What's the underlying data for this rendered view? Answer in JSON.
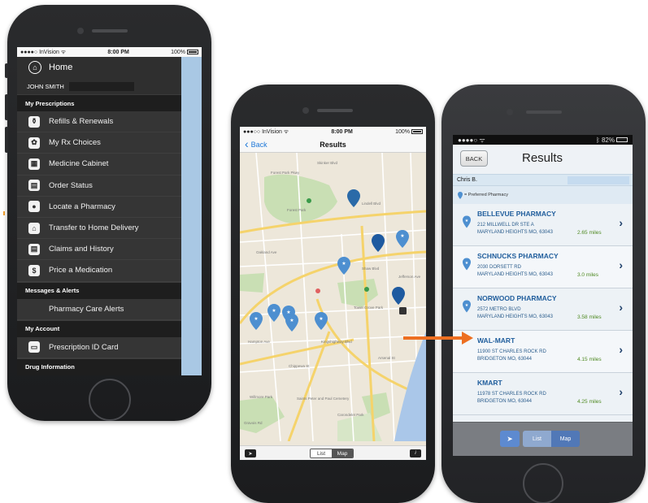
{
  "phone1": {
    "status": {
      "carrier": "●●●●○ InVision ᯤ",
      "time": "8:00 PM",
      "battery": "100%"
    },
    "home_label": "Home",
    "user_name": "JOHN SMITH",
    "sections": [
      {
        "title": "My Prescriptions",
        "items": [
          {
            "label": "Refills & Renewals",
            "icon": "pill-bottle-icon",
            "glyph": "⚱"
          },
          {
            "label": "My Rx Choices",
            "icon": "rx-choices-icon",
            "glyph": "✿"
          },
          {
            "label": "Medicine Cabinet",
            "icon": "cabinet-icon",
            "glyph": "▦"
          },
          {
            "label": "Order Status",
            "icon": "order-status-icon",
            "glyph": "▤"
          },
          {
            "label": "Locate a Pharmacy",
            "icon": "location-pin-icon",
            "glyph": "●"
          },
          {
            "label": "Transfer to Home Delivery",
            "icon": "house-icon",
            "glyph": "⌂"
          },
          {
            "label": "Claims and History",
            "icon": "claims-icon",
            "glyph": "▤"
          },
          {
            "label": "Price a Medication",
            "icon": "dollar-icon",
            "glyph": "$"
          }
        ]
      },
      {
        "title": "Messages & Alerts",
        "items": [
          {
            "label": "Pharmacy Care Alerts",
            "icon": "",
            "glyph": ""
          }
        ]
      },
      {
        "title": "My Account",
        "items": [
          {
            "label": "Prescription ID Card",
            "icon": "id-card-icon",
            "glyph": "▭"
          }
        ]
      },
      {
        "title": "Drug Information",
        "items": []
      }
    ]
  },
  "phone2": {
    "status": {
      "carrier": "●●●○○ InVision ᯤ",
      "time": "8:00 PM",
      "battery": "100%"
    },
    "back_label": "Back",
    "title": "Results",
    "map_labels": [
      "Forest Park Pkwy",
      "Forest Park",
      "Skinker Blvd",
      "Lindell Blvd",
      "Oakland Ave",
      "Tower Grove Park",
      "Shaw Blvd",
      "Arsenal St",
      "Gravois Rd",
      "Carondelet Park",
      "Willmore Park",
      "Saints Peter and Paul Cemetery",
      "Chippewa St",
      "Hampton Ave",
      "Kingshighway Blvd",
      "Jefferson Ave"
    ],
    "segment": {
      "list": "List",
      "map": "Map"
    },
    "info_label": "i"
  },
  "phone3": {
    "status": {
      "carrier": "●●●●○ ᯤ",
      "battery": "82%"
    },
    "back_label": "BACK",
    "title": "Results",
    "user": "Chris B.",
    "preferred_legend": "= Preferred Pharmacy",
    "pharmacies": [
      {
        "name": "BELLEVUE PHARMACY",
        "addr1": "212 MILLWELL DR STE A",
        "addr2": "MARYLAND HEIGHTS MO, 63043",
        "distance": "2.65 miles",
        "preferred": true
      },
      {
        "name": "SCHNUCKS PHARMACY",
        "addr1": "2030 DORSETT RD",
        "addr2": "MARYLAND HEIGHTS MO, 63043",
        "distance": "3.0 miles",
        "preferred": true
      },
      {
        "name": "NORWOOD PHARMACY",
        "addr1": "2572 METRO BLVD",
        "addr2": "MARYLAND HEIGHTS MO, 63043",
        "distance": "3.58 miles",
        "preferred": true
      },
      {
        "name": "WAL-MART",
        "addr1": "11900 ST CHARLES ROCK RD",
        "addr2": "BRIDGETON MO, 63044",
        "distance": "4.15 miles",
        "preferred": false
      },
      {
        "name": "KMART",
        "addr1": "11978 ST CHARLES ROCK RD",
        "addr2": "BRIDGETON MO, 63044",
        "distance": "4.25 miles",
        "preferred": false
      }
    ],
    "segment": {
      "list": "List",
      "map": "Map"
    }
  },
  "colors": {
    "accent_blue": "#1e78d8",
    "pin_blue": "#2a6aa8",
    "distance_green": "#4f8a22",
    "arrow_orange": "#ed6f21",
    "menu_bg": "#2f2f2f"
  }
}
